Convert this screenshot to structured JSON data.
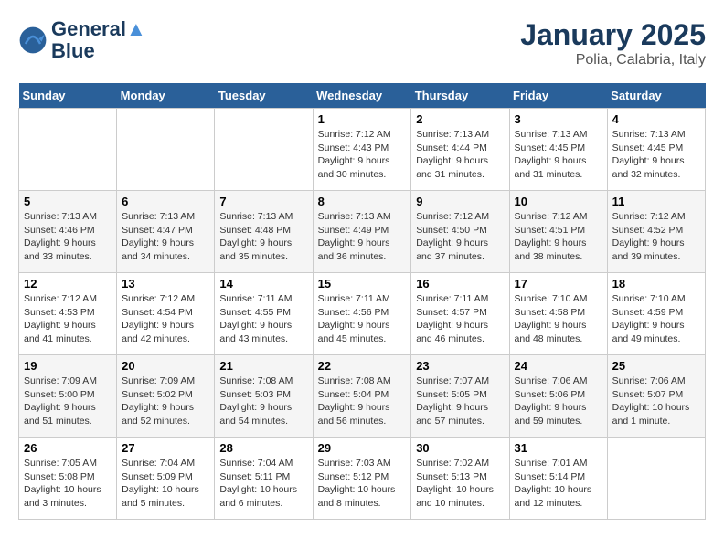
{
  "logo": {
    "line1": "General",
    "line2": "Blue"
  },
  "title": "January 2025",
  "subtitle": "Polia, Calabria, Italy",
  "weekdays": [
    "Sunday",
    "Monday",
    "Tuesday",
    "Wednesday",
    "Thursday",
    "Friday",
    "Saturday"
  ],
  "weeks": [
    [
      {
        "day": "",
        "info": ""
      },
      {
        "day": "",
        "info": ""
      },
      {
        "day": "",
        "info": ""
      },
      {
        "day": "1",
        "info": "Sunrise: 7:12 AM\nSunset: 4:43 PM\nDaylight: 9 hours\nand 30 minutes."
      },
      {
        "day": "2",
        "info": "Sunrise: 7:13 AM\nSunset: 4:44 PM\nDaylight: 9 hours\nand 31 minutes."
      },
      {
        "day": "3",
        "info": "Sunrise: 7:13 AM\nSunset: 4:45 PM\nDaylight: 9 hours\nand 31 minutes."
      },
      {
        "day": "4",
        "info": "Sunrise: 7:13 AM\nSunset: 4:45 PM\nDaylight: 9 hours\nand 32 minutes."
      }
    ],
    [
      {
        "day": "5",
        "info": "Sunrise: 7:13 AM\nSunset: 4:46 PM\nDaylight: 9 hours\nand 33 minutes."
      },
      {
        "day": "6",
        "info": "Sunrise: 7:13 AM\nSunset: 4:47 PM\nDaylight: 9 hours\nand 34 minutes."
      },
      {
        "day": "7",
        "info": "Sunrise: 7:13 AM\nSunset: 4:48 PM\nDaylight: 9 hours\nand 35 minutes."
      },
      {
        "day": "8",
        "info": "Sunrise: 7:13 AM\nSunset: 4:49 PM\nDaylight: 9 hours\nand 36 minutes."
      },
      {
        "day": "9",
        "info": "Sunrise: 7:12 AM\nSunset: 4:50 PM\nDaylight: 9 hours\nand 37 minutes."
      },
      {
        "day": "10",
        "info": "Sunrise: 7:12 AM\nSunset: 4:51 PM\nDaylight: 9 hours\nand 38 minutes."
      },
      {
        "day": "11",
        "info": "Sunrise: 7:12 AM\nSunset: 4:52 PM\nDaylight: 9 hours\nand 39 minutes."
      }
    ],
    [
      {
        "day": "12",
        "info": "Sunrise: 7:12 AM\nSunset: 4:53 PM\nDaylight: 9 hours\nand 41 minutes."
      },
      {
        "day": "13",
        "info": "Sunrise: 7:12 AM\nSunset: 4:54 PM\nDaylight: 9 hours\nand 42 minutes."
      },
      {
        "day": "14",
        "info": "Sunrise: 7:11 AM\nSunset: 4:55 PM\nDaylight: 9 hours\nand 43 minutes."
      },
      {
        "day": "15",
        "info": "Sunrise: 7:11 AM\nSunset: 4:56 PM\nDaylight: 9 hours\nand 45 minutes."
      },
      {
        "day": "16",
        "info": "Sunrise: 7:11 AM\nSunset: 4:57 PM\nDaylight: 9 hours\nand 46 minutes."
      },
      {
        "day": "17",
        "info": "Sunrise: 7:10 AM\nSunset: 4:58 PM\nDaylight: 9 hours\nand 48 minutes."
      },
      {
        "day": "18",
        "info": "Sunrise: 7:10 AM\nSunset: 4:59 PM\nDaylight: 9 hours\nand 49 minutes."
      }
    ],
    [
      {
        "day": "19",
        "info": "Sunrise: 7:09 AM\nSunset: 5:00 PM\nDaylight: 9 hours\nand 51 minutes."
      },
      {
        "day": "20",
        "info": "Sunrise: 7:09 AM\nSunset: 5:02 PM\nDaylight: 9 hours\nand 52 minutes."
      },
      {
        "day": "21",
        "info": "Sunrise: 7:08 AM\nSunset: 5:03 PM\nDaylight: 9 hours\nand 54 minutes."
      },
      {
        "day": "22",
        "info": "Sunrise: 7:08 AM\nSunset: 5:04 PM\nDaylight: 9 hours\nand 56 minutes."
      },
      {
        "day": "23",
        "info": "Sunrise: 7:07 AM\nSunset: 5:05 PM\nDaylight: 9 hours\nand 57 minutes."
      },
      {
        "day": "24",
        "info": "Sunrise: 7:06 AM\nSunset: 5:06 PM\nDaylight: 9 hours\nand 59 minutes."
      },
      {
        "day": "25",
        "info": "Sunrise: 7:06 AM\nSunset: 5:07 PM\nDaylight: 10 hours\nand 1 minute."
      }
    ],
    [
      {
        "day": "26",
        "info": "Sunrise: 7:05 AM\nSunset: 5:08 PM\nDaylight: 10 hours\nand 3 minutes."
      },
      {
        "day": "27",
        "info": "Sunrise: 7:04 AM\nSunset: 5:09 PM\nDaylight: 10 hours\nand 5 minutes."
      },
      {
        "day": "28",
        "info": "Sunrise: 7:04 AM\nSunset: 5:11 PM\nDaylight: 10 hours\nand 6 minutes."
      },
      {
        "day": "29",
        "info": "Sunrise: 7:03 AM\nSunset: 5:12 PM\nDaylight: 10 hours\nand 8 minutes."
      },
      {
        "day": "30",
        "info": "Sunrise: 7:02 AM\nSunset: 5:13 PM\nDaylight: 10 hours\nand 10 minutes."
      },
      {
        "day": "31",
        "info": "Sunrise: 7:01 AM\nSunset: 5:14 PM\nDaylight: 10 hours\nand 12 minutes."
      },
      {
        "day": "",
        "info": ""
      }
    ]
  ]
}
